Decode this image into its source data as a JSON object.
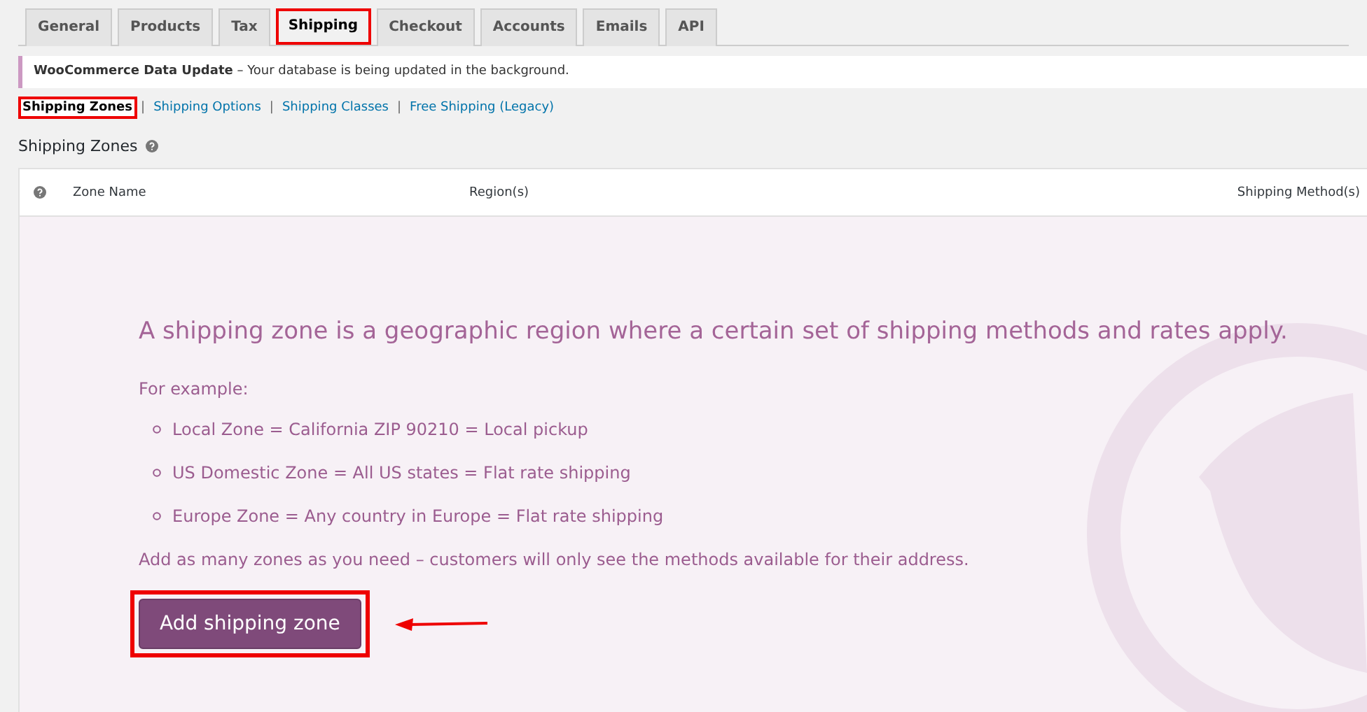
{
  "tabs": [
    {
      "label": "General",
      "selected": false,
      "highlighted": false
    },
    {
      "label": "Products",
      "selected": false,
      "highlighted": false
    },
    {
      "label": "Tax",
      "selected": false,
      "highlighted": false
    },
    {
      "label": "Shipping",
      "selected": true,
      "highlighted": true
    },
    {
      "label": "Checkout",
      "selected": false,
      "highlighted": false
    },
    {
      "label": "Accounts",
      "selected": false,
      "highlighted": false
    },
    {
      "label": "Emails",
      "selected": false,
      "highlighted": false
    },
    {
      "label": "API",
      "selected": false,
      "highlighted": false
    }
  ],
  "notice": {
    "title": "WooCommerce Data Update",
    "message": "Your database is being updated in the background.",
    "separator": "–"
  },
  "subnav": [
    {
      "label": "Shipping Zones",
      "selected": true,
      "highlighted": true
    },
    {
      "label": "Shipping Options",
      "selected": false,
      "highlighted": false
    },
    {
      "label": "Shipping Classes",
      "selected": false,
      "highlighted": false
    },
    {
      "label": "Free Shipping (Legacy)",
      "selected": false,
      "highlighted": false
    }
  ],
  "subnav_separator": "|",
  "heading": "Shipping Zones",
  "table": {
    "columns": [
      "Zone Name",
      "Region(s)",
      "Shipping Method(s)"
    ]
  },
  "blank_state": {
    "headline": "A shipping zone is a geographic region where a certain set of shipping methods and rates apply.",
    "intro": "For example:",
    "examples": [
      "Local Zone = California ZIP 90210 = Local pickup",
      "US Domestic Zone = All US states = Flat rate shipping",
      "Europe Zone = Any country in Europe = Flat rate shipping"
    ],
    "footer": "Add as many zones as you need – customers will only see the methods available for their address.",
    "button": {
      "label": "Add shipping zone",
      "highlighted": true
    }
  }
}
